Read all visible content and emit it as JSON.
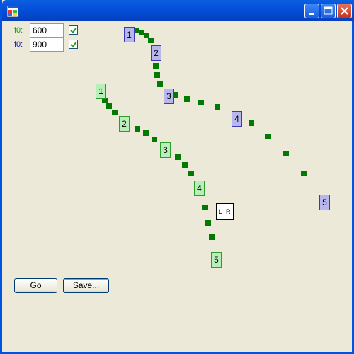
{
  "window": {
    "title": ""
  },
  "fields": [
    {
      "label": "f0:",
      "value": "600",
      "checked": true,
      "label_color": "#1a9a1a"
    },
    {
      "label": "f0:",
      "value": "900",
      "checked": true,
      "label_color": "#1a1aa0"
    }
  ],
  "buttons": {
    "go": "Go",
    "save": "Save..."
  },
  "markers": {
    "blue": [
      "1",
      "2",
      "3",
      "4",
      "5"
    ],
    "green": [
      "1",
      "2",
      "3",
      "4",
      "5"
    ]
  },
  "lr_box": {
    "left": "L",
    "right": "R"
  },
  "colors": {
    "blue_marker": "#b7b7ee",
    "green_marker": "#b8efb8",
    "dot": "#007a00"
  }
}
